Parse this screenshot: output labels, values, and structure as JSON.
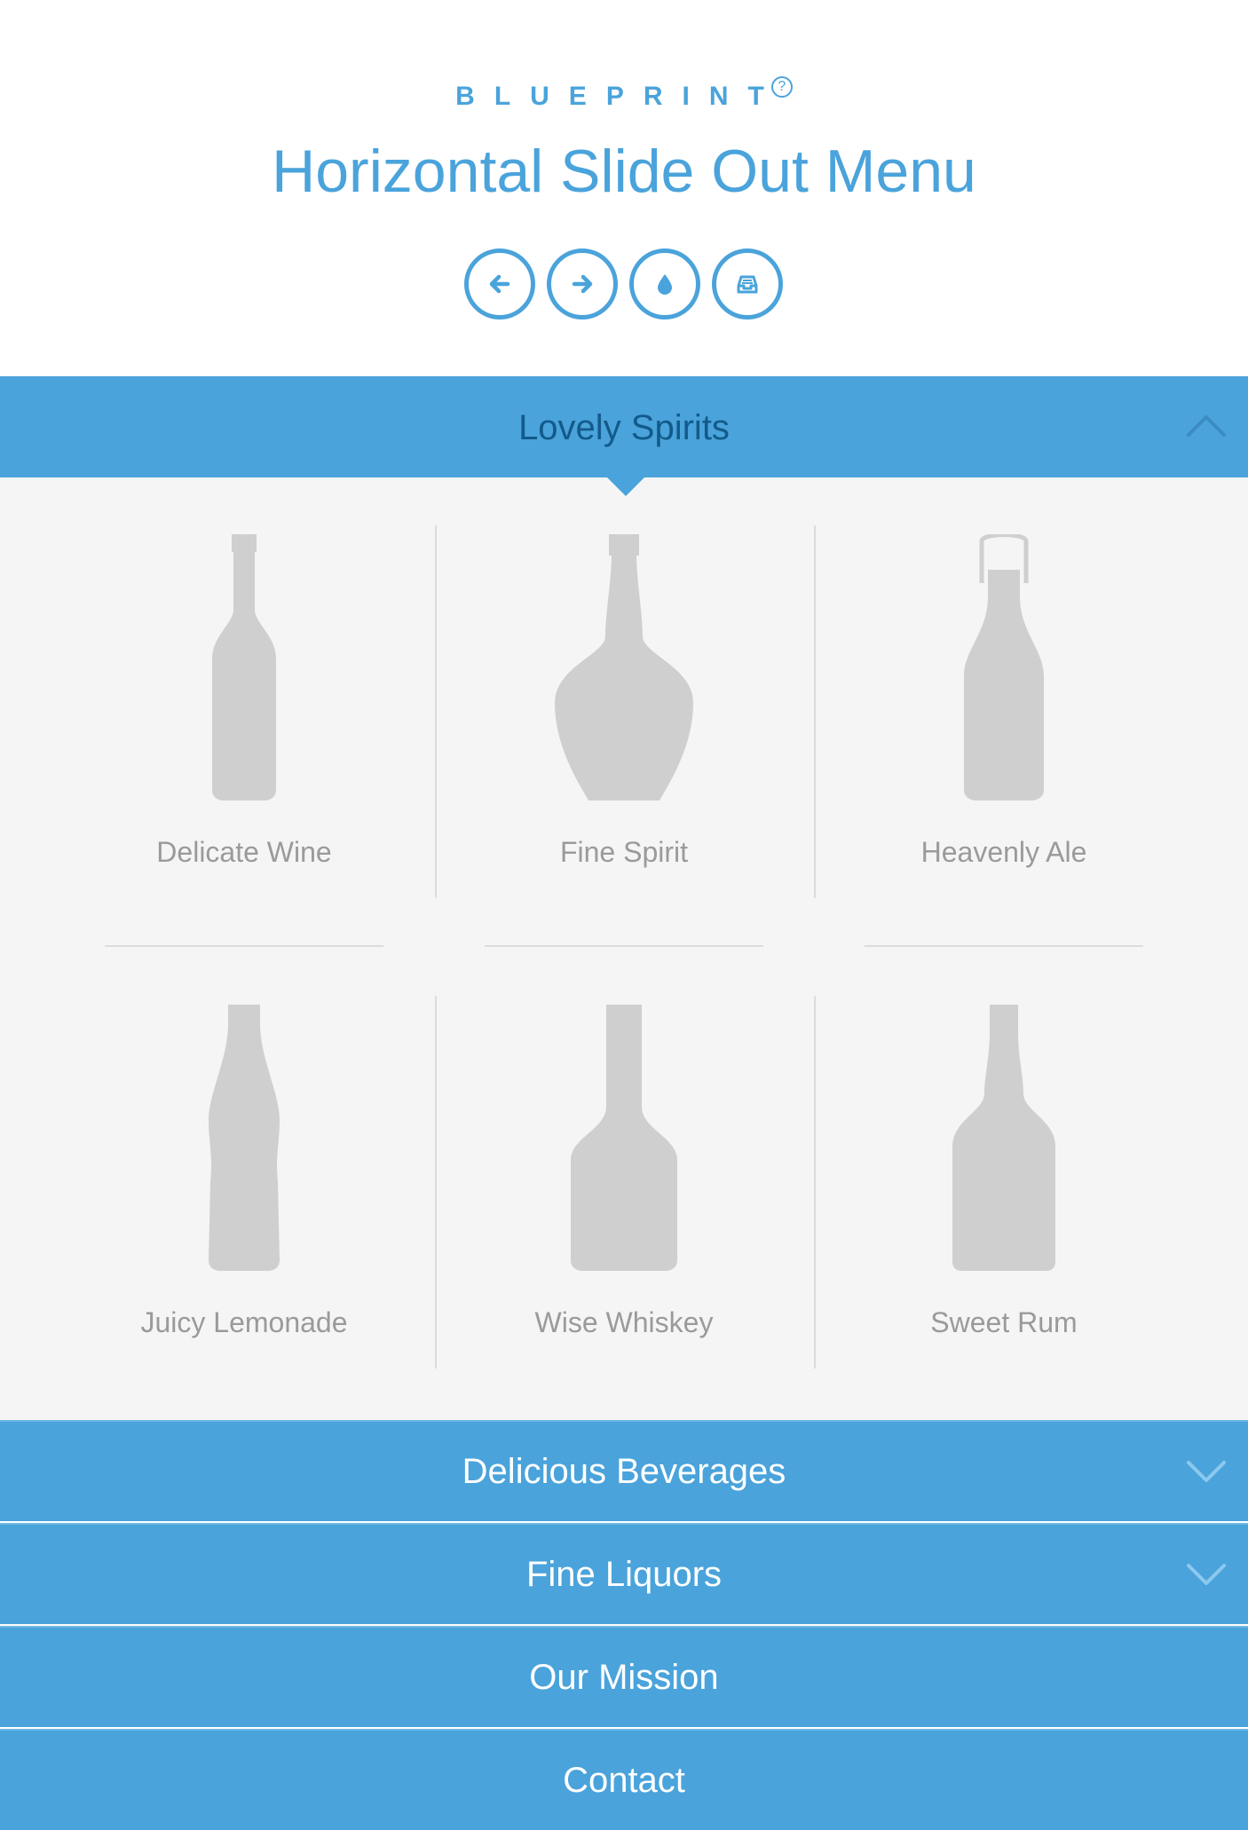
{
  "header": {
    "brand": "BLUEPRINT",
    "brand_badge": "?",
    "title": "Horizontal Slide Out Menu",
    "nav_buttons": [
      {
        "name": "previous-demo-button",
        "icon": "arrow-left-icon"
      },
      {
        "name": "next-demo-button",
        "icon": "arrow-right-icon"
      },
      {
        "name": "codrops-button",
        "icon": "drop-icon"
      },
      {
        "name": "archive-button",
        "icon": "inbox-icon"
      }
    ]
  },
  "menu": {
    "active_section": {
      "label": "Lovely Spirits",
      "icon": "chevron-up-icon"
    },
    "items": [
      {
        "label": "Delicate Wine",
        "icon": "wine-bottle-icon"
      },
      {
        "label": "Fine Spirit",
        "icon": "spirit-bottle-icon"
      },
      {
        "label": "Heavenly Ale",
        "icon": "ale-bottle-icon"
      },
      {
        "label": "Juicy Lemonade",
        "icon": "lemonade-bottle-icon"
      },
      {
        "label": "Wise Whiskey",
        "icon": "whiskey-bottle-icon"
      },
      {
        "label": "Sweet Rum",
        "icon": "rum-bottle-icon"
      }
    ],
    "sections": [
      {
        "label": "Delicious Beverages",
        "icon": "chevron-down-icon"
      },
      {
        "label": "Fine Liquors",
        "icon": "chevron-down-icon"
      },
      {
        "label": "Our Mission"
      },
      {
        "label": "Contact"
      }
    ]
  },
  "colors": {
    "accent": "#4aa3db",
    "active_label": "#125a8a",
    "bottle": "#cfcfcf",
    "panel_bg": "#f5f5f5",
    "item_text": "#9a9a9a"
  }
}
